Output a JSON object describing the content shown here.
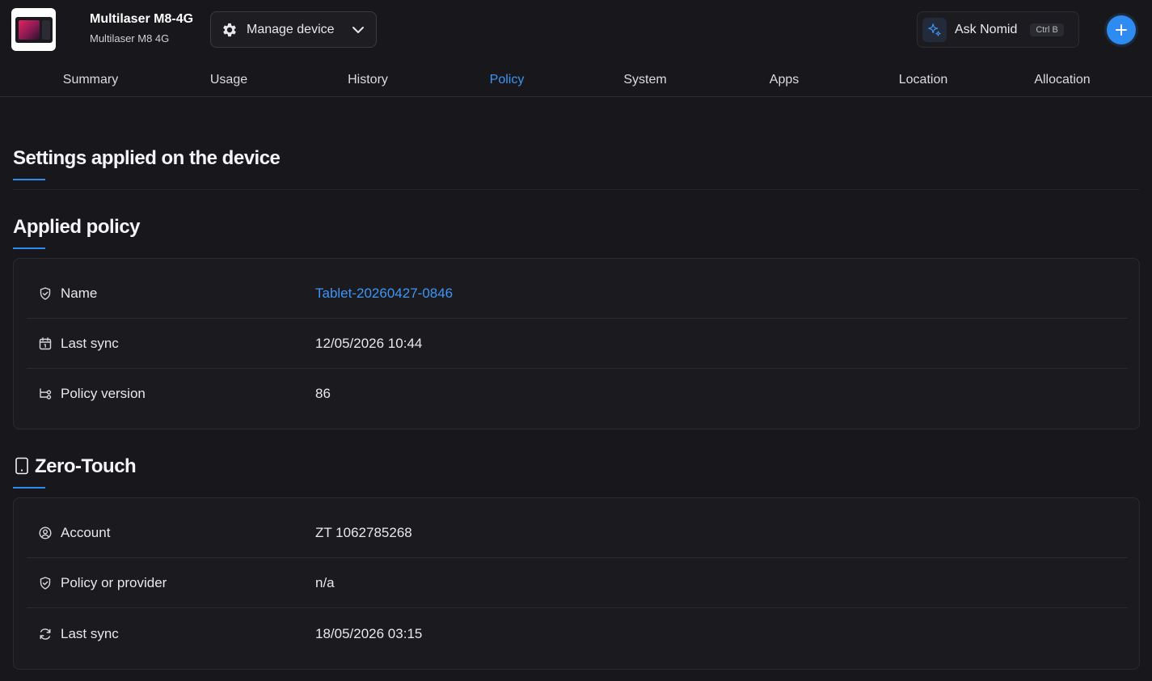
{
  "device": {
    "title": "Multilaser M8-4G",
    "subtitle": "Multilaser M8 4G",
    "thumbnail_icon": "tablet-thumbnail"
  },
  "toolbar": {
    "manage_label": "Manage device",
    "ask_label": "Ask Nomid",
    "ask_shortcut": "Ctrl B",
    "add_icon": "plus-icon"
  },
  "tabs": [
    {
      "label": "Summary"
    },
    {
      "label": "Usage"
    },
    {
      "label": "History"
    },
    {
      "label": "Policy",
      "active": true
    },
    {
      "label": "System"
    },
    {
      "label": "Apps"
    },
    {
      "label": "Location"
    },
    {
      "label": "Allocation"
    }
  ],
  "sections": {
    "settings_title": "Settings applied on the device",
    "applied_title": "Applied policy",
    "zero_touch_title": "Zero-Touch"
  },
  "applied_policy": [
    {
      "icon": "shield-icon",
      "key": "Name",
      "value": "Tablet-20260427-0846",
      "link": true
    },
    {
      "icon": "calendar-icon",
      "key": "Last sync",
      "value": "12/05/2026 10:44"
    },
    {
      "icon": "version-icon",
      "key": "Policy version",
      "value": "86"
    }
  ],
  "zero_touch": [
    {
      "icon": "account-icon",
      "key": "Account",
      "value": "ZT 1062785268"
    },
    {
      "icon": "shield-icon",
      "key": "Policy or provider",
      "value": "n/a"
    },
    {
      "icon": "sync-icon",
      "key": "Last sync",
      "value": "18/05/2026 03:15"
    }
  ],
  "colors": {
    "accent": "#2e8bf2",
    "link": "#3d95f5",
    "background": "#18181c"
  }
}
